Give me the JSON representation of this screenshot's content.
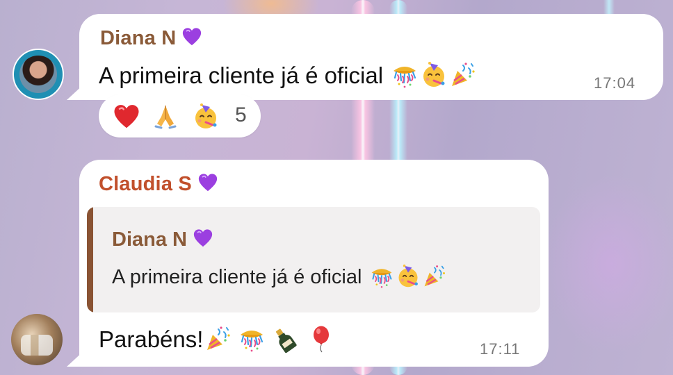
{
  "messages": [
    {
      "sender": "Diana N",
      "text": "A primeira cliente já é oficial",
      "time": "17:04",
      "emojis": [
        "confetti-ball",
        "partying-face",
        "party-popper"
      ],
      "reactions": {
        "emojis": [
          "red-heart",
          "folded-hands",
          "partying-face"
        ],
        "count": "5"
      }
    },
    {
      "sender": "Claudia S",
      "reply_to": {
        "sender": "Diana N",
        "text": "A primeira cliente já é oficial"
      },
      "text": "Parabéns!",
      "time": "17:11",
      "emojis": [
        "party-popper",
        "confetti-ball",
        "champagne-bottle",
        "balloon"
      ]
    }
  ],
  "colors": {
    "diana_name": "#8a5a38",
    "claudia_name": "#c1502c",
    "quote_bar": "#8a5333",
    "heart_emoji": "#9b3fe0"
  }
}
